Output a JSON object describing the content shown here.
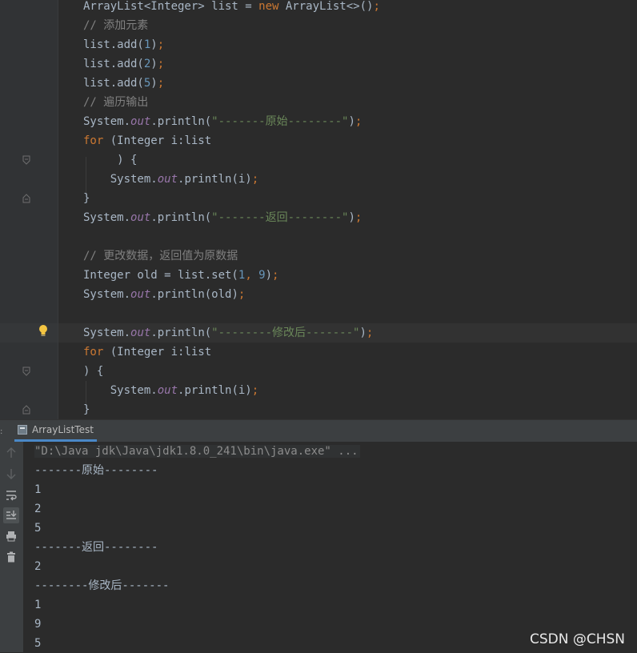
{
  "editor": {
    "lines": [
      {
        "segments": [
          {
            "t": "ArrayList<Integer> list = ",
            "c": ""
          },
          {
            "t": "new",
            "c": "kw"
          },
          {
            "t": " ArrayList<>()",
            "c": ""
          },
          {
            "t": ";",
            "c": "kw"
          }
        ]
      },
      {
        "segments": [
          {
            "t": "// ",
            "c": "cmt"
          },
          {
            "t": "添加元素",
            "c": "cmt cjk"
          }
        ]
      },
      {
        "segments": [
          {
            "t": "list.add(",
            "c": ""
          },
          {
            "t": "1",
            "c": "num"
          },
          {
            "t": ")",
            "c": ""
          },
          {
            "t": ";",
            "c": "kw"
          }
        ]
      },
      {
        "segments": [
          {
            "t": "list.add(",
            "c": ""
          },
          {
            "t": "2",
            "c": "num"
          },
          {
            "t": ")",
            "c": ""
          },
          {
            "t": ";",
            "c": "kw"
          }
        ]
      },
      {
        "segments": [
          {
            "t": "list.add(",
            "c": ""
          },
          {
            "t": "5",
            "c": "num"
          },
          {
            "t": ")",
            "c": ""
          },
          {
            "t": ";",
            "c": "kw"
          }
        ]
      },
      {
        "segments": [
          {
            "t": "// ",
            "c": "cmt"
          },
          {
            "t": "遍历输出",
            "c": "cmt cjk"
          }
        ]
      },
      {
        "segments": [
          {
            "t": "System.",
            "c": ""
          },
          {
            "t": "out",
            "c": "fld"
          },
          {
            "t": ".println(",
            "c": ""
          },
          {
            "t": "\"-------",
            "c": "str"
          },
          {
            "t": "原始",
            "c": "str cjk"
          },
          {
            "t": "--------\"",
            "c": "str"
          },
          {
            "t": ")",
            "c": ""
          },
          {
            "t": ";",
            "c": "kw"
          }
        ]
      },
      {
        "segments": [
          {
            "t": "for",
            "c": "kw"
          },
          {
            "t": " (Integer i:list",
            "c": ""
          }
        ]
      },
      {
        "segments": [
          {
            "t": "     ) {",
            "c": ""
          }
        ]
      },
      {
        "segments": [
          {
            "t": "    System.",
            "c": ""
          },
          {
            "t": "out",
            "c": "fld"
          },
          {
            "t": ".println(i)",
            "c": ""
          },
          {
            "t": ";",
            "c": "kw"
          }
        ]
      },
      {
        "segments": [
          {
            "t": "}",
            "c": ""
          }
        ]
      },
      {
        "segments": [
          {
            "t": "System.",
            "c": ""
          },
          {
            "t": "out",
            "c": "fld"
          },
          {
            "t": ".println(",
            "c": ""
          },
          {
            "t": "\"-------",
            "c": "str"
          },
          {
            "t": "返回",
            "c": "str cjk"
          },
          {
            "t": "--------\"",
            "c": "str"
          },
          {
            "t": ")",
            "c": ""
          },
          {
            "t": ";",
            "c": "kw"
          }
        ]
      },
      {
        "segments": []
      },
      {
        "segments": [
          {
            "t": "// ",
            "c": "cmt"
          },
          {
            "t": "更改数据，返回值为原数据",
            "c": "cmt cjk"
          }
        ]
      },
      {
        "segments": [
          {
            "t": "Integer old = list.set(",
            "c": ""
          },
          {
            "t": "1",
            "c": "num"
          },
          {
            "t": ", ",
            "c": "kw"
          },
          {
            "t": "9",
            "c": "num"
          },
          {
            "t": ")",
            "c": ""
          },
          {
            "t": ";",
            "c": "kw"
          }
        ]
      },
      {
        "segments": [
          {
            "t": "System.",
            "c": ""
          },
          {
            "t": "out",
            "c": "fld"
          },
          {
            "t": ".println(old)",
            "c": ""
          },
          {
            "t": ";",
            "c": "kw"
          }
        ]
      },
      {
        "segments": []
      },
      {
        "segments": [
          {
            "t": "System.",
            "c": ""
          },
          {
            "t": "out",
            "c": "fld"
          },
          {
            "t": ".println(",
            "c": ""
          },
          {
            "t": "\"--------",
            "c": "str"
          },
          {
            "t": "修改后",
            "c": "str cjk"
          },
          {
            "t": "-------\"",
            "c": "str"
          },
          {
            "t": ")",
            "c": ""
          },
          {
            "t": ";",
            "c": "kw"
          }
        ]
      },
      {
        "segments": [
          {
            "t": "for",
            "c": "kw"
          },
          {
            "t": " (Integer i:list",
            "c": ""
          }
        ]
      },
      {
        "segments": [
          {
            "t": ") {",
            "c": ""
          }
        ]
      },
      {
        "segments": [
          {
            "t": "    System.",
            "c": ""
          },
          {
            "t": "out",
            "c": "fld"
          },
          {
            "t": ".println(i)",
            "c": ""
          },
          {
            "t": ";",
            "c": "kw"
          }
        ]
      },
      {
        "segments": [
          {
            "t": "}",
            "c": ""
          }
        ]
      }
    ],
    "icons": {
      "fold": "fold-marker-icon",
      "bulb": "lightbulb-icon"
    }
  },
  "run_panel": {
    "tab_label": "ArrayListTest",
    "tab_icon": "run-config-icon",
    "tools": [
      "arrow-up-icon",
      "arrow-down-icon",
      "soft-wrap-icon",
      "scroll-to-end-icon",
      "print-icon",
      "trash-icon"
    ],
    "command": "\"D:\\Java jdk\\Java\\jdk1.8.0_241\\bin\\java.exe\" ...",
    "output": [
      "-------原始--------",
      "1",
      "2",
      "5",
      "-------返回--------",
      "2",
      "--------修改后-------",
      "1",
      "9",
      "5"
    ]
  },
  "watermark": "CSDN @CHSN",
  "colors": {
    "keyword": "#cc7832",
    "string": "#6a8759",
    "number": "#6897bb",
    "field": "#9876aa",
    "comment": "#808080",
    "text": "#a9b7c6"
  }
}
